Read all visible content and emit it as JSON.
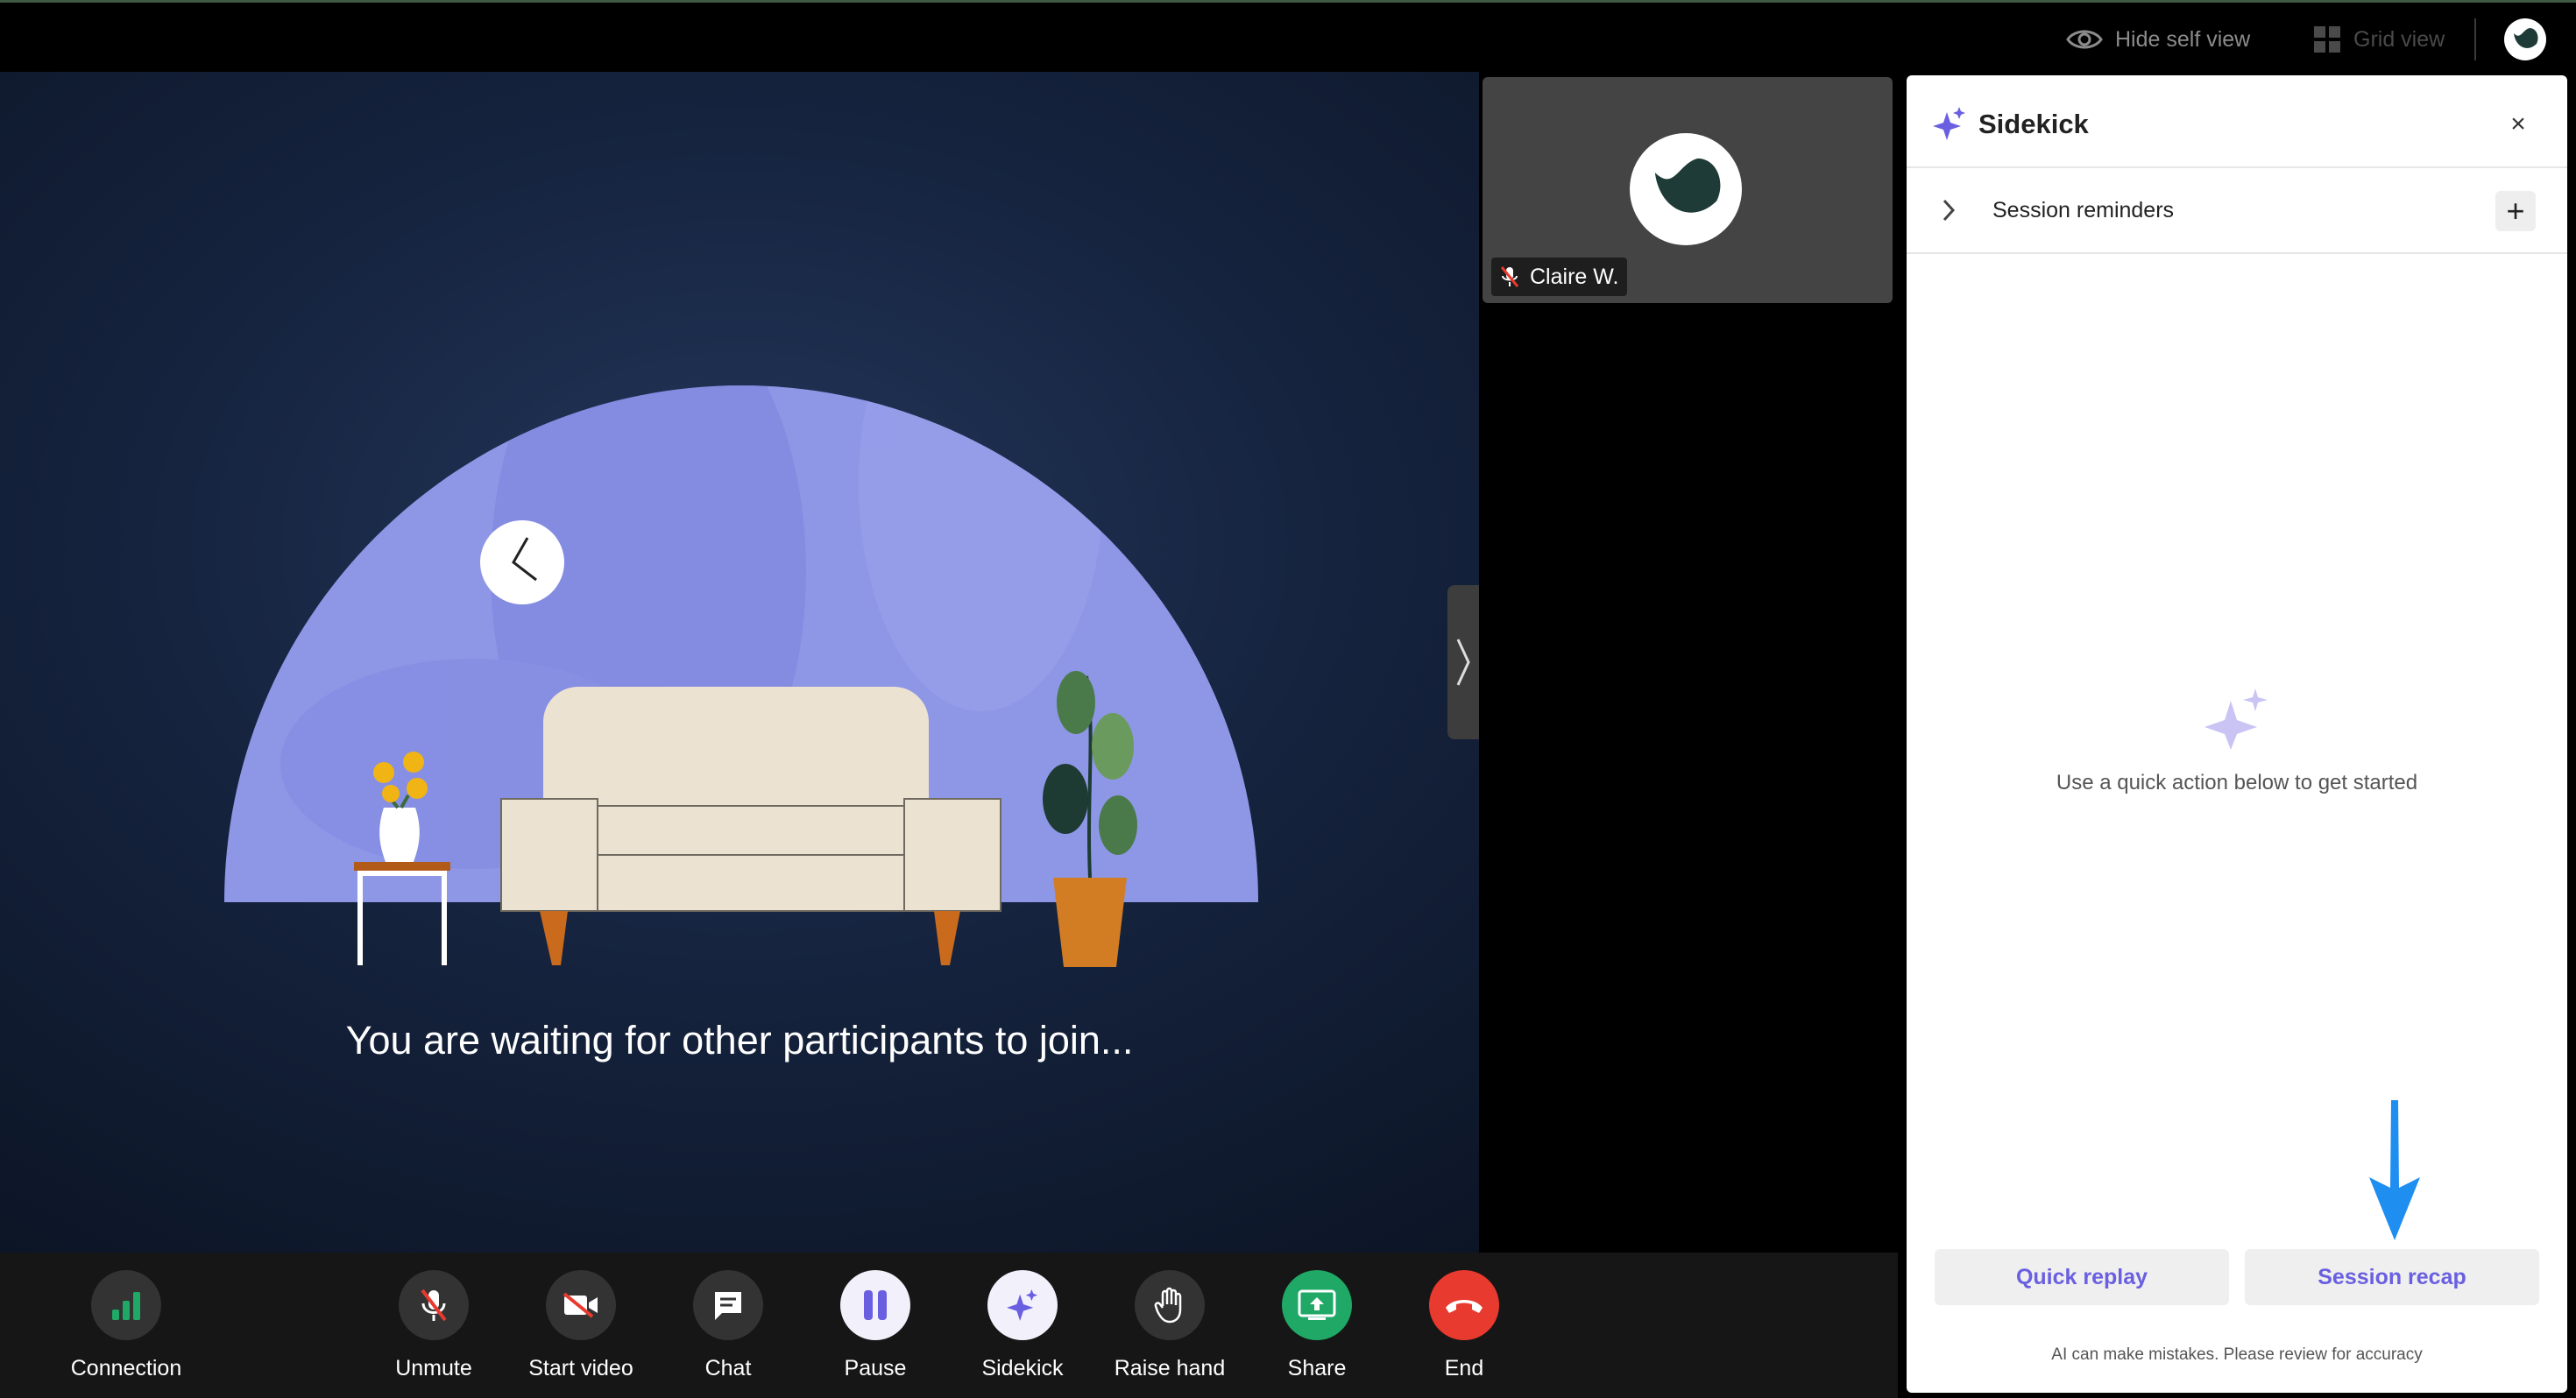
{
  "topbar": {
    "hide_self_view": "Hide self view",
    "grid_view": "Grid view"
  },
  "stage": {
    "waiting_message": "You are waiting for other participants to join..."
  },
  "self_tile": {
    "name": "Claire W."
  },
  "sidekick": {
    "title": "Sidekick",
    "close": "×",
    "reminders_label": "Session reminders",
    "add": "+",
    "empty_message": "Use a quick action below to get started",
    "quick_replay": "Quick replay",
    "session_recap": "Session recap",
    "disclaimer": "AI can make mistakes. Please review for accuracy"
  },
  "controls": {
    "connection": "Connection",
    "unmute": "Unmute",
    "start_video": "Start video",
    "chat": "Chat",
    "pause": "Pause",
    "sidekick": "Sidekick",
    "raise_hand": "Raise hand",
    "share": "Share",
    "end": "End"
  },
  "colors": {
    "accent": "#6a5fe0",
    "share_green": "#1fa866",
    "end_red": "#e83a2e",
    "arrow_blue": "#1f8ef1",
    "dome": "#8e97e6"
  },
  "icons": [
    "eye-icon",
    "grid-icon",
    "logo-icon",
    "muted-mic-icon",
    "sparkle-icon",
    "close-icon",
    "chevron-right-icon",
    "plus-icon",
    "signal-bars-icon",
    "video-off-icon",
    "chat-icon",
    "pause-icon",
    "hand-icon",
    "share-screen-icon",
    "phone-end-icon",
    "arrow-down-icon"
  ]
}
